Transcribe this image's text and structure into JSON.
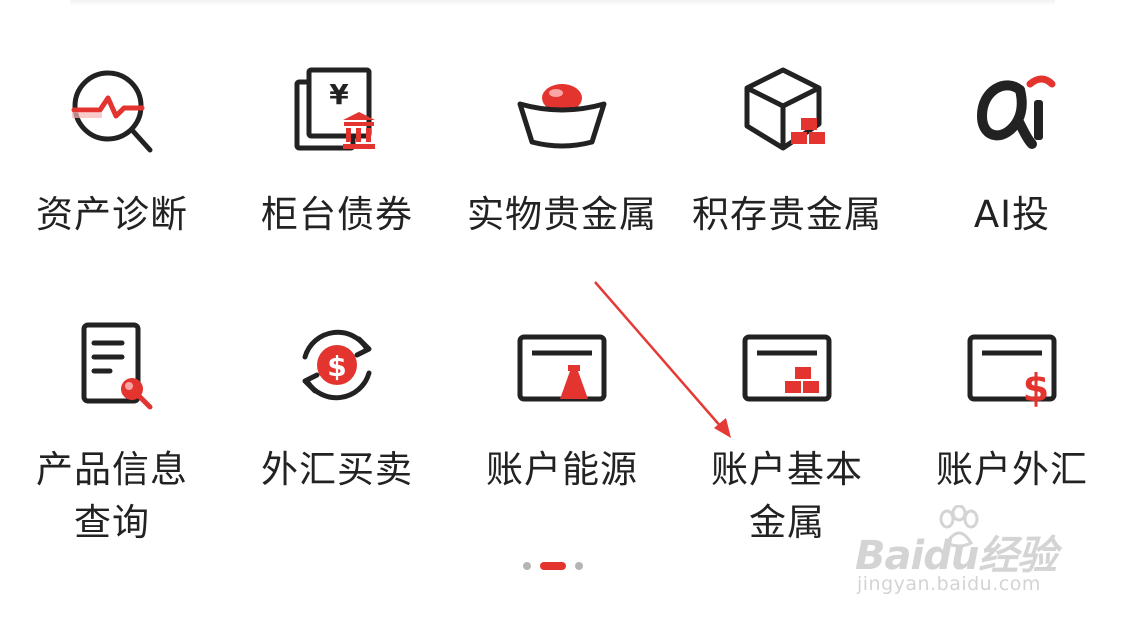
{
  "colors": {
    "accent": "#e3342f",
    "icon_stroke": "#222222",
    "text": "#222222",
    "dot_inactive": "#b5b5b5",
    "annotation_arrow": "#e53935",
    "watermark": "#d4d4d4"
  },
  "grid": {
    "items": [
      {
        "label": "资产诊断",
        "icon": "magnifier-chart-icon"
      },
      {
        "label": "柜台债券",
        "icon": "yen-bond-certificate-icon"
      },
      {
        "label": "实物贵金属",
        "icon": "gold-ingot-icon"
      },
      {
        "label": "积存贵金属",
        "icon": "cube-gold-bars-icon"
      },
      {
        "label": "AI投",
        "icon": "ai-logo-icon"
      },
      {
        "label": "产品信息\n查询",
        "label_line1": "产品信息",
        "label_line2": "查询",
        "icon": "document-search-icon"
      },
      {
        "label": "外汇买卖",
        "icon": "dollar-exchange-icon"
      },
      {
        "label": "账户能源",
        "icon": "card-flask-icon"
      },
      {
        "label": "账户基本\n金属",
        "label_line1": "账户基本",
        "label_line2": "金属",
        "icon": "card-gold-bars-icon"
      },
      {
        "label": "账户外汇",
        "icon": "card-dollar-icon"
      }
    ]
  },
  "pager": {
    "page_count": 3,
    "active_index": 1
  },
  "watermark": {
    "brand": "Baidu经验",
    "url": "jingyan.baidu.com"
  }
}
